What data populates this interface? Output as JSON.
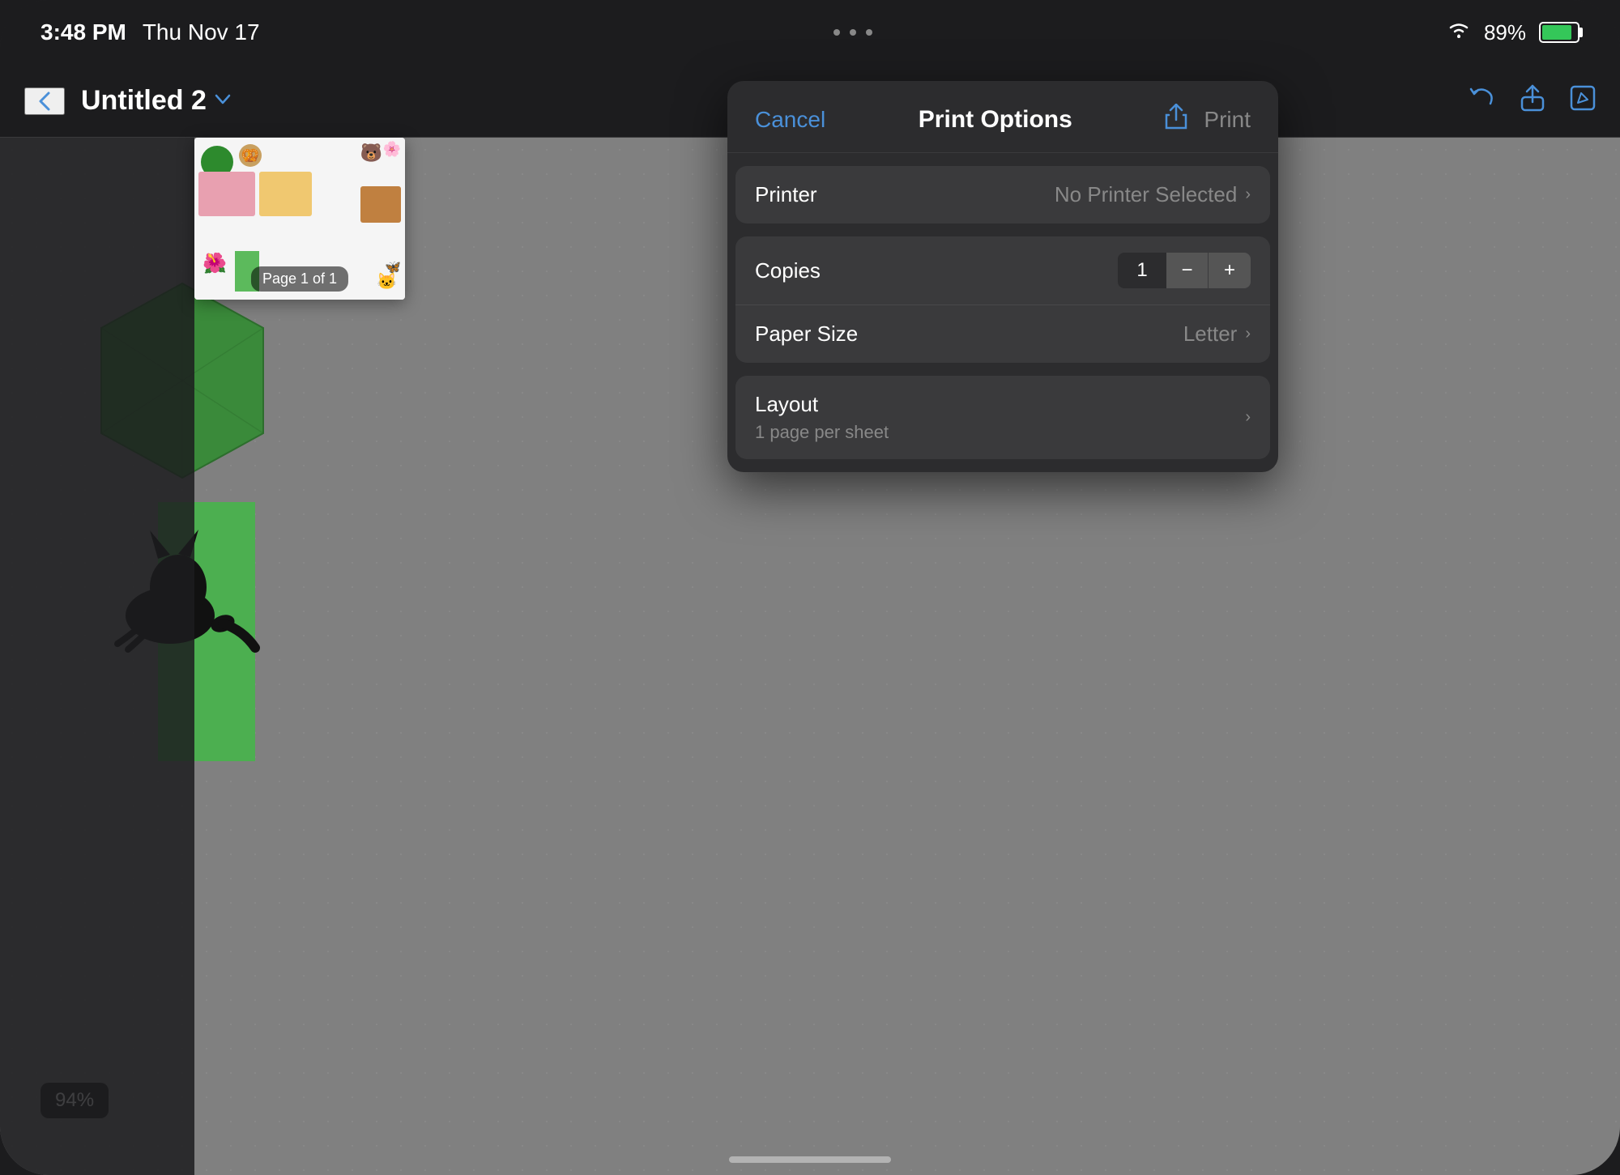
{
  "statusBar": {
    "time": "3:48 PM",
    "date": "Thu Nov 17",
    "battery": "89%"
  },
  "toolbar": {
    "backLabel": "‹",
    "documentTitle": "Untitled 2",
    "chevronLabel": "⌄"
  },
  "printDialog": {
    "title": "Print Options",
    "cancelLabel": "Cancel",
    "printLabel": "Print",
    "sections": {
      "printer": {
        "label": "Printer",
        "value": "No Printer Selected"
      },
      "copies": {
        "label": "Copies",
        "value": "1"
      },
      "paperSize": {
        "label": "Paper Size",
        "value": "Letter"
      },
      "layout": {
        "label": "Layout",
        "subtitle": "1 page per sheet"
      }
    }
  },
  "pagePreview": {
    "label": "Page 1 of 1"
  },
  "zoomBadge": {
    "value": "94%"
  }
}
